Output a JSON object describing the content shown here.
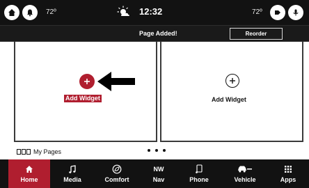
{
  "status_bar": {
    "temp_left": "72º",
    "time": "12:32",
    "temp_right": "72º",
    "weather_icon": "partly-sunny-icon"
  },
  "notification": {
    "message": "Page Added!",
    "reorder_label": "Reorder"
  },
  "widgets": {
    "left_label": "Add Widget",
    "right_label": "Add Widget"
  },
  "my_pages": {
    "label": "My Pages"
  },
  "nav": {
    "items": [
      {
        "label": "Home",
        "icon": "home-icon",
        "active": true
      },
      {
        "label": "Media",
        "icon": "music-note-icon",
        "active": false
      },
      {
        "label": "Comfort",
        "icon": "climate-icon",
        "active": false
      },
      {
        "label": "Nav",
        "icon": "compass-icon",
        "active": false,
        "sublabel": "NW"
      },
      {
        "label": "Phone",
        "icon": "phone-icon",
        "active": false
      },
      {
        "label": "Vehicle",
        "icon": "car-icon",
        "active": false
      },
      {
        "label": "Apps",
        "icon": "apps-grid-icon",
        "active": false
      }
    ]
  },
  "colors": {
    "accent": "#b01e2f",
    "bar_background": "#121212"
  }
}
